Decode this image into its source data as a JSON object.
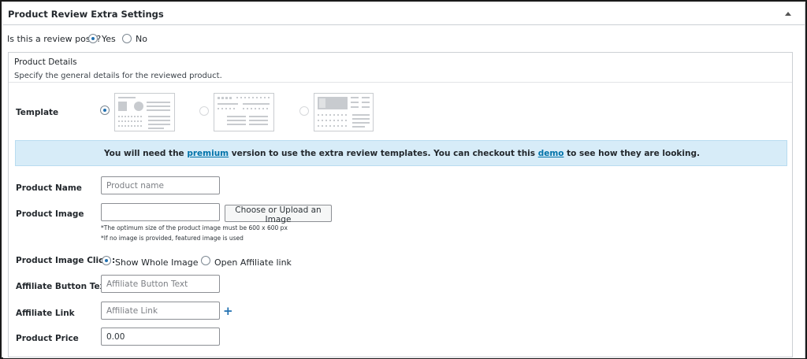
{
  "postbox": {
    "title": "Product Review Extra Settings",
    "toggle_icon": "triangle-up-icon"
  },
  "review_post": {
    "question": "Is this a review post ?",
    "options": [
      {
        "label": "Yes",
        "checked": true
      },
      {
        "label": "No",
        "checked": false
      }
    ]
  },
  "product_details": {
    "title": "Product Details",
    "description": "Specify the general details for the reviewed product."
  },
  "template": {
    "label": "Template",
    "options": [
      {
        "name": "default",
        "selected": true
      },
      {
        "name": "template-2",
        "selected": false
      },
      {
        "name": "template-3",
        "selected": false
      }
    ]
  },
  "notice": {
    "text_before": "You will need the ",
    "premium_link": "premium",
    "text_middle": " version to use the extra review templates. You can checkout this ",
    "demo_link": "demo",
    "text_after": " to see how they are looking.",
    "colors": {
      "background": "#d7ecf8",
      "link": "#0073aa"
    }
  },
  "fields": {
    "product_name": {
      "label": "Product Name",
      "placeholder": "Product name",
      "value": ""
    },
    "product_image": {
      "label": "Product Image",
      "value": "",
      "button": "Choose or Upload an Image",
      "hint_1": "*The optimum size of the product image must be 600 x 600 px",
      "hint_2": "*If no image is provided, featured image is used"
    },
    "image_click": {
      "label": "Product Image Click :",
      "options": [
        {
          "label": "Show Whole Image",
          "checked": true
        },
        {
          "label": "Open Affiliate link",
          "checked": false
        }
      ]
    },
    "affiliate_button_text": {
      "label": "Affiliate Button Text",
      "placeholder": "Affiliate Button Text",
      "value": ""
    },
    "affiliate_link": {
      "label": "Affiliate Link",
      "placeholder": "Affiliate Link",
      "value": "",
      "add_icon": "+"
    },
    "product_price": {
      "label": "Product Price",
      "value": "0.00"
    }
  },
  "accent_color": "#2271b1"
}
